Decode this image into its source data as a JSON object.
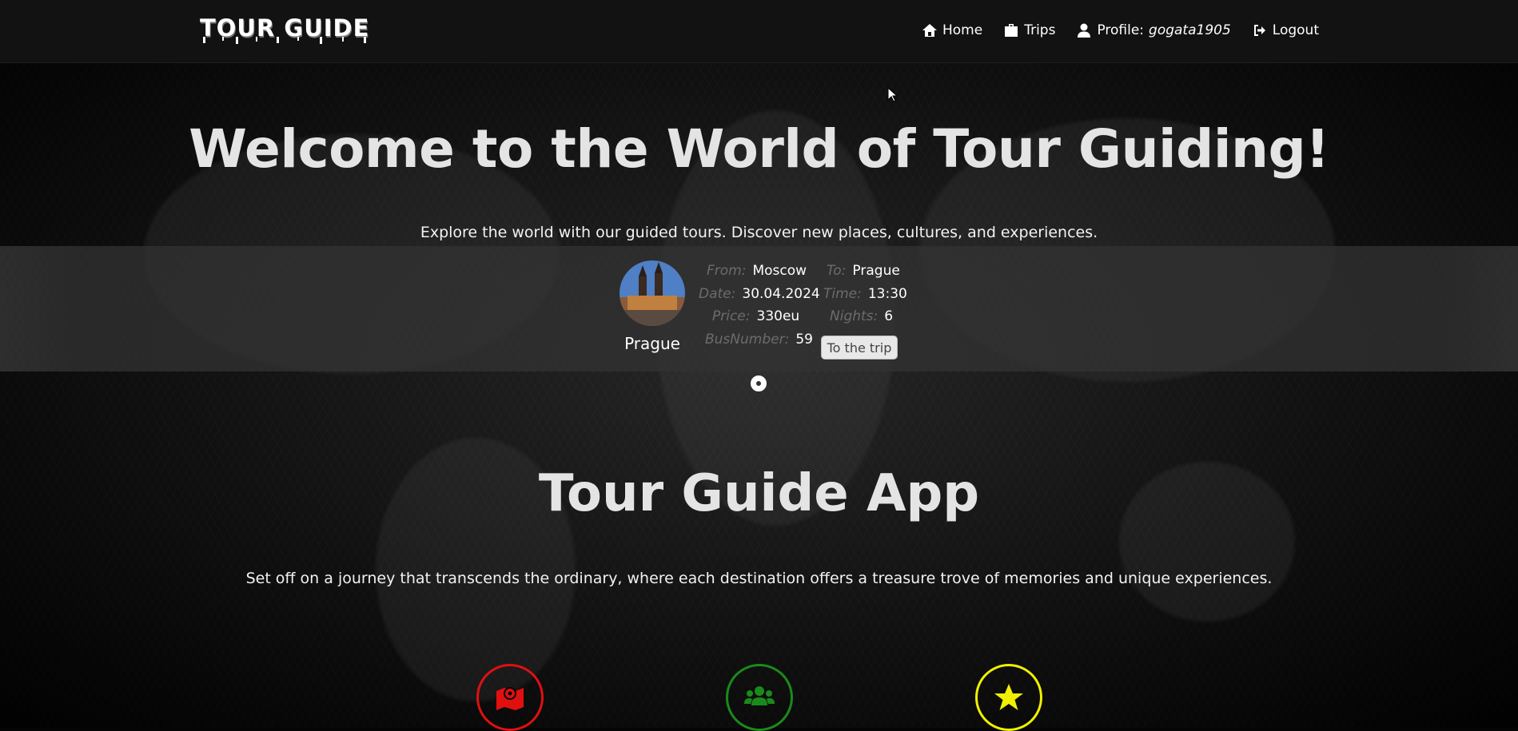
{
  "brand": {
    "logo": "TOUR GUIDE"
  },
  "nav": {
    "home": "Home",
    "trips": "Trips",
    "profile_label": "Profile:",
    "profile_user": "gogata1905",
    "logout": "Logout"
  },
  "hero": {
    "title": "Welcome to the World of Tour Guiding!",
    "subtitle": "Explore the world with our guided tours. Discover new places, cultures, and experiences."
  },
  "trip_card": {
    "city": "Prague",
    "from_label": "From:",
    "from": "Moscow",
    "to_label": "To:",
    "to": "Prague",
    "date_label": "Date:",
    "date": "30.04.2024",
    "time_label": "Time:",
    "time": "13:30",
    "price_label": "Price:",
    "price": "330eu",
    "nights_label": "Nights:",
    "nights": "6",
    "bus_label": "BusNumber:",
    "bus": "59",
    "button": "To the trip"
  },
  "app_section": {
    "title": "Tour Guide App",
    "subtitle": "Set off on a journey that transcends the ordinary, where each destination offers a treasure trove of memories and unique experiences."
  },
  "features": [
    {
      "icon": "map-marker-icon",
      "color": "#e01010"
    },
    {
      "icon": "users-icon",
      "color": "#1a8a1a"
    },
    {
      "icon": "star-icon",
      "color": "#f0f000"
    }
  ],
  "colors": {
    "navbar": "#121212",
    "button": "#e8e8e8"
  }
}
